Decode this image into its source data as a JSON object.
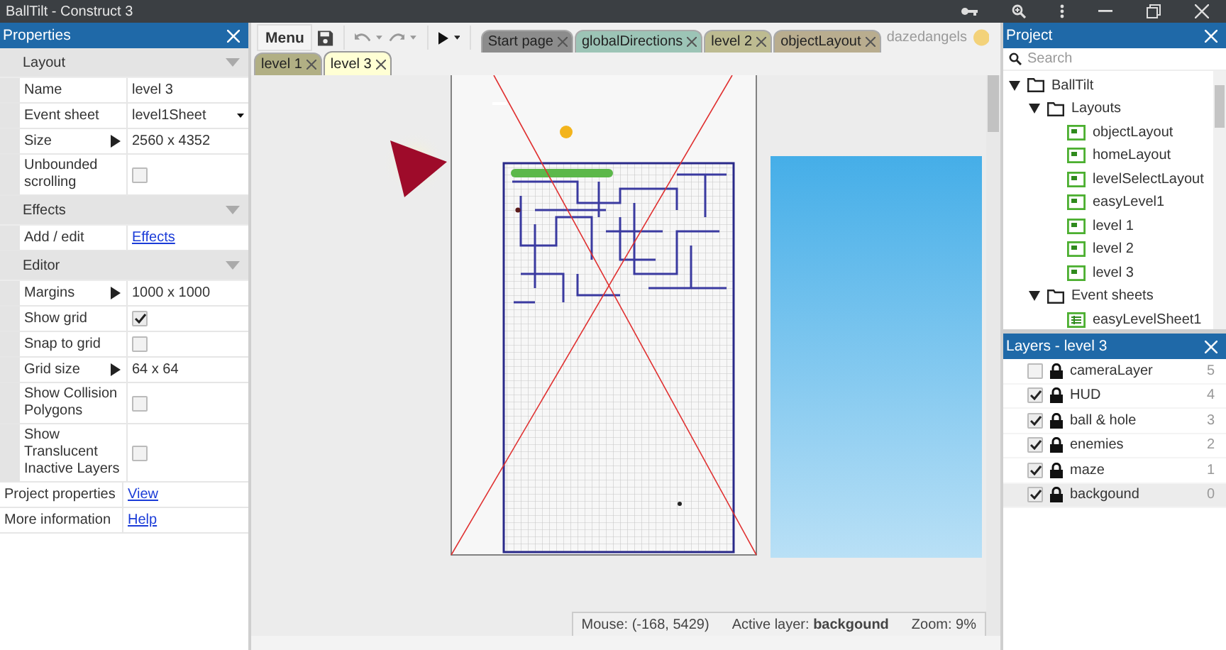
{
  "window": {
    "title": "BallTilt - Construct 3"
  },
  "properties": {
    "title": "Properties",
    "sections": [
      {
        "title": "Layout",
        "rows": [
          {
            "label": "Name",
            "kind": "text",
            "value": "level 3"
          },
          {
            "label": "Event sheet",
            "kind": "dropdown",
            "value": "level1Sheet"
          },
          {
            "label": "Size",
            "kind": "expandable",
            "value": "2560 x 4352"
          },
          {
            "label": "Unbounded scrolling",
            "kind": "checkbox",
            "checked": false
          }
        ]
      },
      {
        "title": "Effects",
        "rows": [
          {
            "label": "Add / edit",
            "kind": "link",
            "value": "Effects"
          }
        ]
      },
      {
        "title": "Editor",
        "rows": [
          {
            "label": "Margins",
            "kind": "expandable",
            "value": "1000 x 1000"
          },
          {
            "label": "Show grid",
            "kind": "checkbox",
            "checked": true
          },
          {
            "label": "Snap to grid",
            "kind": "checkbox",
            "checked": false
          },
          {
            "label": "Grid size",
            "kind": "expandable",
            "value": "64 x 64"
          },
          {
            "label": "Show Collision Polygons",
            "kind": "checkbox",
            "checked": false
          },
          {
            "label": "Show Translucent Inactive Layers",
            "kind": "checkbox",
            "checked": false
          }
        ]
      }
    ],
    "footer_rows": [
      {
        "label": "Project properties",
        "value": "View"
      },
      {
        "label": "More information",
        "value": "Help"
      }
    ]
  },
  "toolbar": {
    "menu": "Menu",
    "user": "dazedangels"
  },
  "tab_rows": [
    [
      {
        "label": "Start page",
        "color": "#8c8c8c",
        "selected": false
      },
      {
        "label": "globalDirections",
        "color": "#9cc4b6",
        "selected": false
      },
      {
        "label": "level 2",
        "color": "#bdbb91",
        "selected": false
      },
      {
        "label": "objectLayout",
        "color": "#b9ad8f",
        "selected": false
      }
    ],
    [
      {
        "label": "level 1",
        "color": "#b1af84",
        "selected": false
      },
      {
        "label": "level 3",
        "color": "#ffffd4",
        "selected": true
      }
    ]
  ],
  "status_bar": {
    "mouse": "Mouse: (-168, 5429)",
    "active_layer_label": "Active layer:",
    "active_layer": "backgound",
    "zoom": "Zoom: 9%"
  },
  "project": {
    "title": "Project",
    "search": {
      "placeholder": "Search"
    },
    "tree": [
      {
        "label": "BallTilt",
        "kind": "folder",
        "expanded": true,
        "children": [
          {
            "label": "Layouts",
            "kind": "folder",
            "expanded": true,
            "children": [
              {
                "label": "objectLayout",
                "kind": "layout"
              },
              {
                "label": "homeLayout",
                "kind": "layout"
              },
              {
                "label": "levelSelectLayout",
                "kind": "layout"
              },
              {
                "label": "easyLevel1",
                "kind": "layout"
              },
              {
                "label": "level 1",
                "kind": "layout"
              },
              {
                "label": "level 2",
                "kind": "layout"
              },
              {
                "label": "level 3",
                "kind": "layout"
              }
            ]
          },
          {
            "label": "Event sheets",
            "kind": "folder",
            "expanded": true,
            "children": [
              {
                "label": "easyLevelSheet1",
                "kind": "sheet"
              }
            ]
          }
        ]
      }
    ]
  },
  "layers": {
    "title": "Layers - level 3",
    "items": [
      {
        "name": "cameraLayer",
        "number": "5",
        "checked": false,
        "selected": false
      },
      {
        "name": "HUD",
        "number": "4",
        "checked": true,
        "selected": false
      },
      {
        "name": "ball & hole",
        "number": "3",
        "checked": true,
        "selected": false
      },
      {
        "name": "enemies",
        "number": "2",
        "checked": true,
        "selected": false
      },
      {
        "name": "maze",
        "number": "1",
        "checked": true,
        "selected": false
      },
      {
        "name": "backgound",
        "number": "0",
        "checked": true,
        "selected": true
      }
    ]
  }
}
